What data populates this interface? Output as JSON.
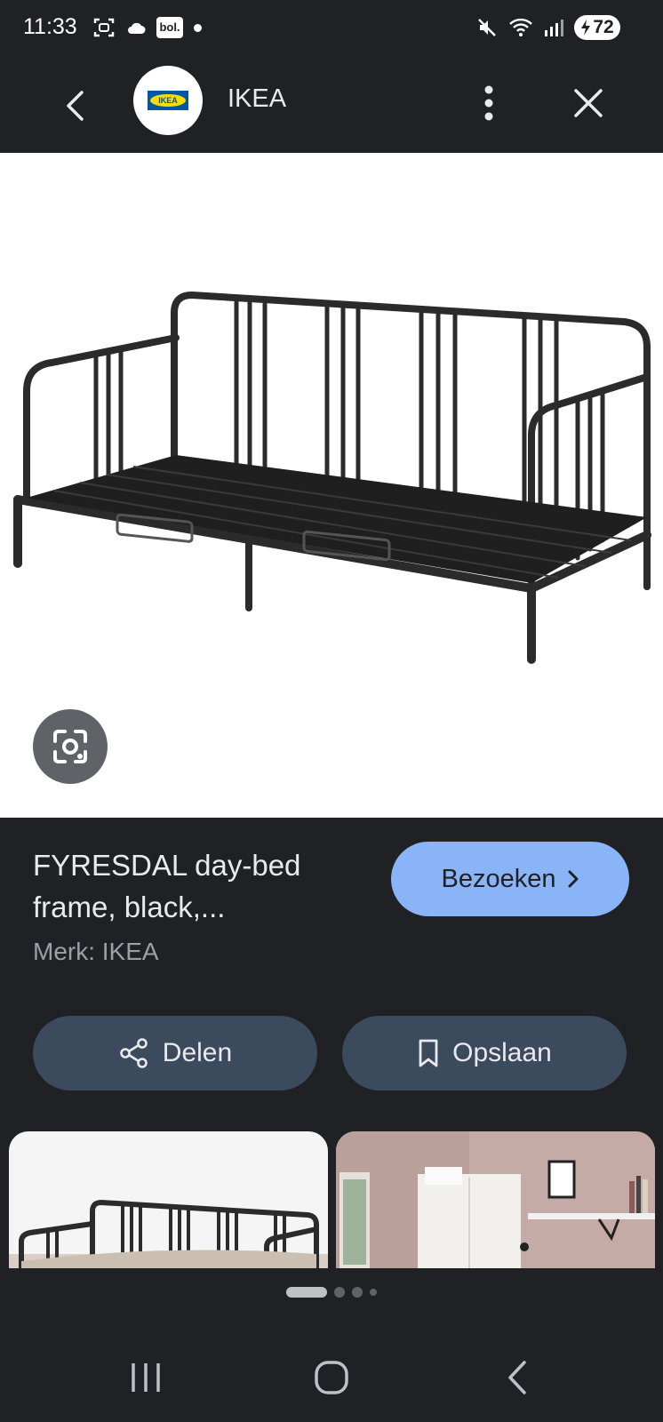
{
  "status": {
    "time": "11:33",
    "bol": "bol.",
    "battery": "72"
  },
  "header": {
    "title": "IKEA",
    "logo_text": "IKEA"
  },
  "product": {
    "title": "FYRESDAL day-bed frame, black,...",
    "brand": "Merk: IKEA",
    "visit_label": "Bezoeken"
  },
  "actions": {
    "share_label": "Delen",
    "save_label": "Opslaan"
  },
  "pager": {
    "count": 4,
    "active": 0
  }
}
